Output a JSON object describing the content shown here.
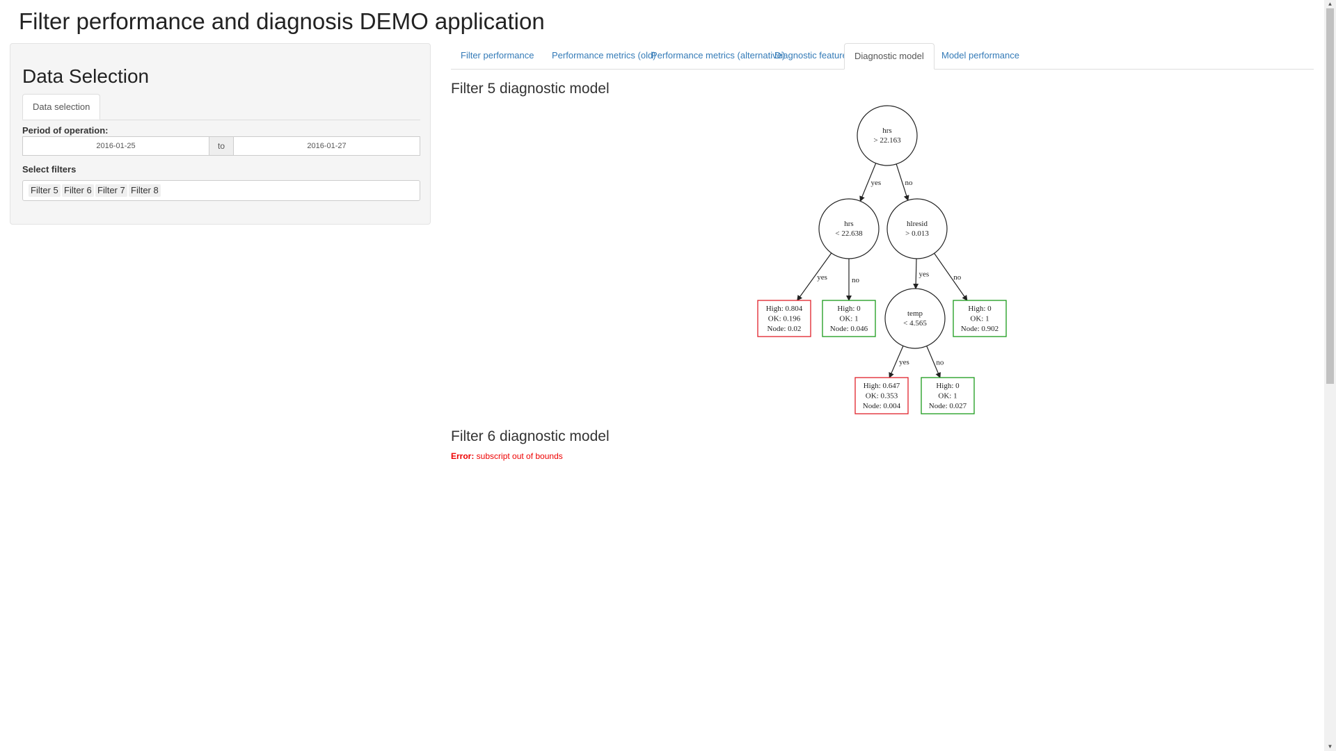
{
  "app": {
    "title": "Filter performance and diagnosis DEMO application"
  },
  "sidebar": {
    "title": "Data Selection",
    "tab_label": "Data selection",
    "period_label": "Period of operation:",
    "date_from": "2016-01-25",
    "date_to": "2016-01-27",
    "date_separator": "to",
    "filters_label": "Select filters",
    "selected_filters": [
      "Filter 5",
      "Filter 6",
      "Filter 7",
      "Filter 8"
    ]
  },
  "main": {
    "tabs": [
      {
        "label": "Filter performance",
        "active": false
      },
      {
        "label": "Performance metrics (old)",
        "active": false
      },
      {
        "label": "Performance metrics (alternative)",
        "active": false
      },
      {
        "label": "Diagnostic features",
        "active": false
      },
      {
        "label": "Diagnostic model",
        "active": true
      },
      {
        "label": "Model performance",
        "active": false
      }
    ],
    "model1_title": "Filter 5 diagnostic model",
    "model2_title": "Filter 6 diagnostic model",
    "error_prefix": "Error:",
    "error_message": " subscript out of bounds"
  },
  "tree": {
    "colors": {
      "high": "#e0202a",
      "ok": "#1a9a1a",
      "edge": "#222222"
    },
    "decisions": [
      {
        "id": "d1",
        "var": "hrs",
        "cond": "> 22.163"
      },
      {
        "id": "d2",
        "var": "hrs",
        "cond": "< 22.638"
      },
      {
        "id": "d3",
        "var": "hlresid",
        "cond": "> 0.013"
      },
      {
        "id": "d4",
        "var": "temp",
        "cond": "< 4.565"
      }
    ],
    "leaves": [
      {
        "id": "l1",
        "class": "high",
        "lines": [
          "High: 0.804",
          "OK: 0.196",
          "Node: 0.02"
        ]
      },
      {
        "id": "l2",
        "class": "ok",
        "lines": [
          "High: 0",
          "OK: 1",
          "Node: 0.046"
        ]
      },
      {
        "id": "l3",
        "class": "ok",
        "lines": [
          "High: 0",
          "OK: 1",
          "Node: 0.902"
        ]
      },
      {
        "id": "l4",
        "class": "high",
        "lines": [
          "High: 0.647",
          "OK: 0.353",
          "Node: 0.004"
        ]
      },
      {
        "id": "l5",
        "class": "ok",
        "lines": [
          "High: 0",
          "OK: 1",
          "Node: 0.027"
        ]
      }
    ],
    "edges": [
      {
        "from": "d1",
        "to": "d2",
        "label": "yes"
      },
      {
        "from": "d1",
        "to": "d3",
        "label": "no"
      },
      {
        "from": "d2",
        "to": "l1",
        "label": "yes"
      },
      {
        "from": "d2",
        "to": "l2",
        "label": "no"
      },
      {
        "from": "d3",
        "to": "d4",
        "label": "yes"
      },
      {
        "from": "d3",
        "to": "l3",
        "label": "no"
      },
      {
        "from": "d4",
        "to": "l4",
        "label": "yes"
      },
      {
        "from": "d4",
        "to": "l5",
        "label": "no"
      }
    ]
  }
}
